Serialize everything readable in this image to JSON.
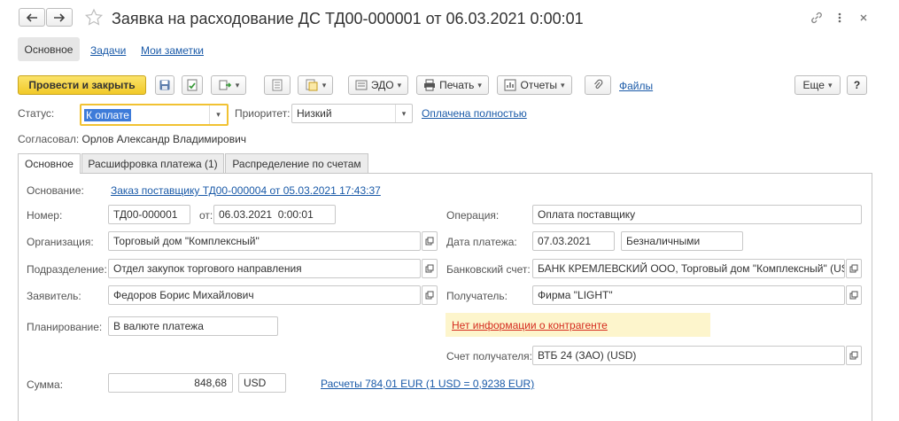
{
  "window": {
    "title": "Заявка на расходование ДС ТД00-000001 от 06.03.2021 0:00:01"
  },
  "nav_tabs": {
    "main": "Основное",
    "tasks": "Задачи",
    "notes": "Мои заметки"
  },
  "toolbar": {
    "post_close": "Провести и закрыть",
    "edo": "ЭДО",
    "print": "Печать",
    "reports": "Отчеты",
    "files": "Файлы",
    "more": "Еще",
    "help": "?"
  },
  "status_row": {
    "status_label": "Статус:",
    "status_value": "К оплате",
    "priority_label": "Приоритет:",
    "priority_value": "Низкий",
    "paid_link": "Оплачена полностью"
  },
  "approved": {
    "label": "Согласовал:",
    "value": "Орлов Александр Владимирович"
  },
  "form_tabs": [
    "Основное",
    "Расшифровка платежа (1)",
    "Распределение по счетам"
  ],
  "fields": {
    "basis_label": "Основание:",
    "basis_link": "Заказ поставщику ТД00-000004 от 05.03.2021 17:43:37",
    "number_label": "Номер:",
    "number_value": "ТД00-000001",
    "from_label": "от:",
    "date_value": "06.03.2021  0:00:01",
    "org_label": "Организация:",
    "org_value": "Торговый дом \"Комплексный\"",
    "dept_label": "Подразделение:",
    "dept_value": "Отдел закупок торгового направления",
    "applicant_label": "Заявитель:",
    "applicant_value": "Федоров Борис Михайлович",
    "planning_label": "Планирование:",
    "planning_value": "В валюте платежа",
    "sum_label": "Сумма:",
    "sum_value": "848,68",
    "currency_value": "USD",
    "rates_link": "Расчеты 784,01 EUR (1 USD = 0,9238 EUR)",
    "operation_label": "Операция:",
    "operation_value": "Оплата поставщику",
    "paydate_label": "Дата платежа:",
    "paydate_value": "07.03.2021",
    "paytype_value": "Безналичными",
    "bank_label": "Банковский счет:",
    "bank_value": "БАНК КРЕМЛЕВСКИЙ ООО, Торговый дом \"Комплексный\" (US",
    "recipient_label": "Получатель:",
    "recipient_value": "Фирма \"LIGHT\"",
    "warning_link": "Нет информации о контрагенте",
    "recip_account_label": "Счет получателя:",
    "recip_account_value": "ВТБ 24 (ЗАО) (USD)"
  },
  "colors": {
    "primary_button": "#f5d23b",
    "link": "#1a5aa8",
    "warning_bg": "#fdf5cc",
    "warning_text": "#d52b1e",
    "focus": "#f1c232"
  }
}
